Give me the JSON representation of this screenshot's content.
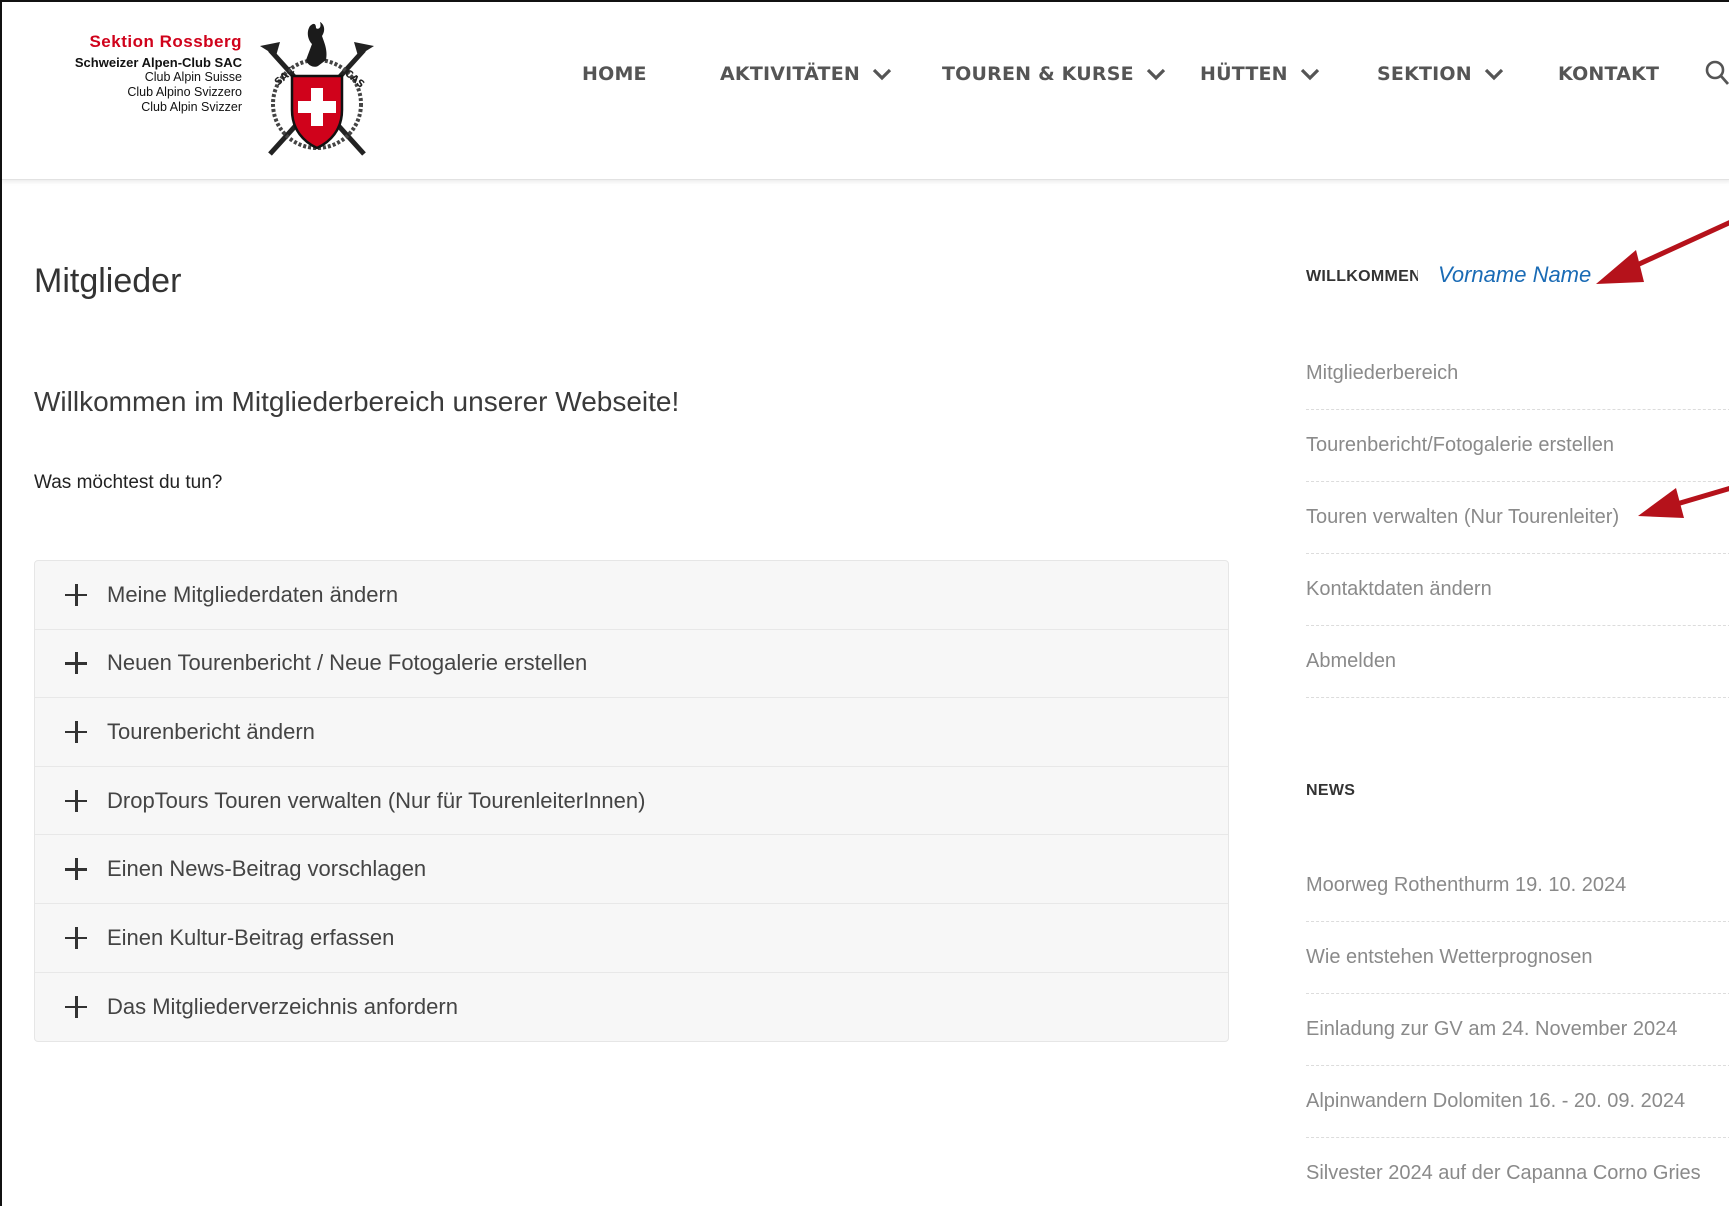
{
  "header": {
    "logo": {
      "section": "Sektion Rossberg",
      "club": "Schweizer Alpen-Club SAC",
      "lines": [
        "Club Alpin Suisse",
        "Club Alpino Svizzero",
        "Club Alpin Svizzer"
      ],
      "emblem_letters": "SAC CAS"
    },
    "nav": [
      {
        "label": "HOME",
        "has_dropdown": false
      },
      {
        "label": "AKTIVITÄTEN",
        "has_dropdown": true
      },
      {
        "label": "TOUREN & KURSE",
        "has_dropdown": true
      },
      {
        "label": "HÜTTEN",
        "has_dropdown": true
      },
      {
        "label": "SEKTION",
        "has_dropdown": true
      },
      {
        "label": "KONTAKT",
        "has_dropdown": false
      }
    ],
    "search_icon": "search-icon"
  },
  "main": {
    "page_title": "Mitglieder",
    "welcome": "Willkommen im Mitgliederbereich unserer Webseite!",
    "question": "Was möchtest du tun?",
    "accordion": [
      "Meine Mitgliederdaten ändern",
      "Neuen Tourenbericht / Neue Fotogalerie erstellen",
      "Tourenbericht ändern",
      "DropTours Touren verwalten (Nur für TourenleiterInnen)",
      "Einen News-Beitrag vorschlagen",
      "Einen Kultur-Beitrag erfassen",
      "Das Mitgliederverzeichnis anfordern"
    ]
  },
  "sidebar": {
    "welcome_label": "WILLKOMMEN",
    "username": "Vorname Name",
    "menu": [
      "Mitgliederbereich",
      "Tourenbericht/Fotogalerie erstellen",
      "Touren verwalten (Nur Tourenleiter)",
      "Kontaktdaten ändern",
      "Abmelden"
    ],
    "news_title": "NEWS",
    "news": [
      "Moorweg Rothenthurm 19. 10. 2024",
      "Wie entstehen Wetterprognosen",
      "Einladung zur GV am 24. November 2024",
      "Alpinwandern Dolomiten 16.  - 20. 09. 2024",
      "Silvester 2024 auf der Capanna Corno Gries"
    ]
  },
  "colors": {
    "brand_red": "#d0021b",
    "link_blue": "#1a6bb5",
    "annotation_arrow": "#b5121b"
  }
}
